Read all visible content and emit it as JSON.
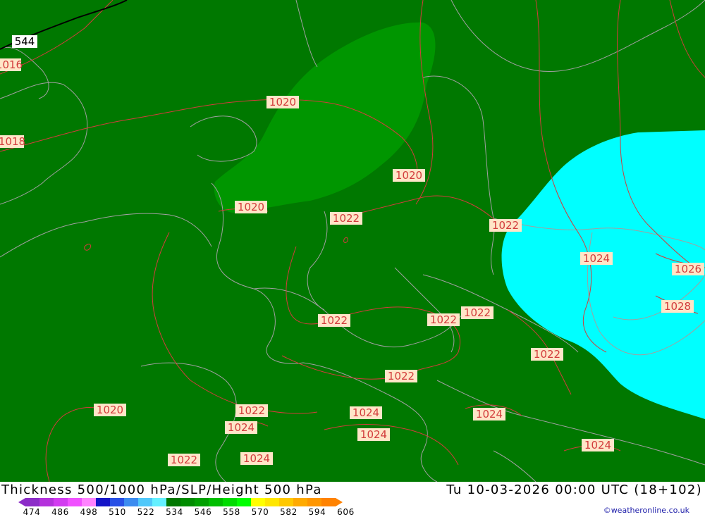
{
  "map": {
    "isobar_labels": [
      "1016",
      "1018",
      "1020",
      "1020",
      "1020",
      "1022",
      "1022",
      "1024",
      "1026",
      "1028",
      "1022",
      "1022",
      "1022",
      "1022",
      "1022",
      "1024",
      "1024",
      "1024",
      "1024",
      "1024",
      "1020",
      "1022",
      "1022"
    ],
    "height_label": "544",
    "colors": {
      "background_green": "#007800",
      "bright_green": "#009600",
      "cyan": "#00ffff",
      "isobar": "#d23c3c",
      "border": "#a0a0a0",
      "height_contour": "#000000"
    }
  },
  "footer": {
    "title_left": "Thickness 500/1000 hPa/SLP/Height 500 hPa",
    "title_right": "Tu 10-03-2026 00:00 UTC (18+102)",
    "credit": "©weatheronline.co.uk",
    "scale_ticks": [
      "474",
      "486",
      "498",
      "510",
      "522",
      "534",
      "546",
      "558",
      "570",
      "582",
      "594",
      "606"
    ],
    "scale_colors": [
      "#8c2cc8",
      "#b432dc",
      "#d23cf0",
      "#f050ff",
      "#ff82ff",
      "#1414c8",
      "#2850e6",
      "#3c8cf0",
      "#50c8fa",
      "#64f0ff",
      "#007800",
      "#008c00",
      "#00a000",
      "#00be00",
      "#00dc00",
      "#00ff00",
      "#ffff00",
      "#ffe600",
      "#ffc800",
      "#ffaa00",
      "#ff9600",
      "#ff8200"
    ]
  }
}
